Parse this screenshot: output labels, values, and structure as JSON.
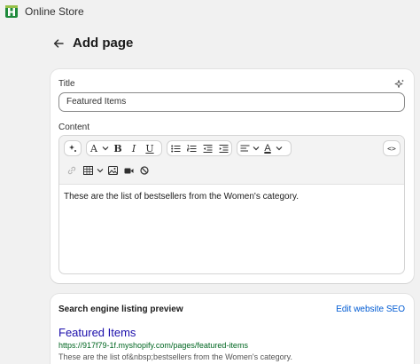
{
  "app": {
    "title": "Online Store"
  },
  "header": {
    "title": "Add page"
  },
  "form": {
    "title_label": "Title",
    "title_value": "Featured Items",
    "content_label": "Content",
    "content_text": "These are the list of bestsellers from the Women's category."
  },
  "toolbar": {
    "font_glyph": "A",
    "bold": "B",
    "italic": "I",
    "underline": "U",
    "color_glyph": "A",
    "html_glyph": "<>"
  },
  "seo": {
    "heading": "Search engine listing preview",
    "edit_link": "Edit website SEO",
    "preview_title": "Featured Items",
    "preview_url": "https://917f79-1f.myshopify.com/pages/featured-items",
    "preview_desc": "These are the list of&nbsp;bestsellers from the Women's category."
  },
  "colors": {
    "background": "#f1f1f1",
    "link": "#005bd3",
    "seo_title": "#1a0dab",
    "seo_url": "#006621",
    "logo_green": "#1f8a3c"
  }
}
